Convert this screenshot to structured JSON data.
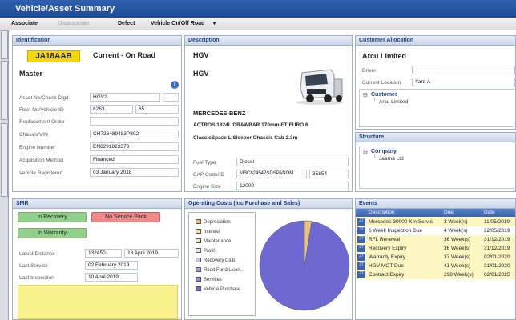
{
  "window": {
    "title": "Vehicle/Asset Summary"
  },
  "toolbar": {
    "associate": "Associate",
    "disassociate": "Disassociate",
    "defect": "Defect",
    "vehicle_on_off_road": "Vehicle On/Off Road"
  },
  "identification": {
    "header": "Identification",
    "reg": "JA18AAB",
    "status": "Current - On Road",
    "category": "Master",
    "fields": [
      {
        "label": "Asset No/Check Digit",
        "value": "HGV2"
      },
      {
        "label": "Fleet No/Vehicle ID",
        "value": "8263",
        "extra": "65"
      },
      {
        "label": "Replacement Order",
        "value": ""
      },
      {
        "label": "Chassis/VIN",
        "value": "CH726489483P802"
      },
      {
        "label": "Engine Number",
        "value": "EN6291823373"
      },
      {
        "label": "Acquisition Method",
        "value": "Financed"
      },
      {
        "label": "Vehicle Registered",
        "value": "03 January 2018"
      }
    ]
  },
  "description": {
    "header": "Description",
    "line1": "HGV",
    "line2": "HGV",
    "make": "MERCEDES-BENZ",
    "model": "ACTROS 1824L DRAWBAR 170mm ET EURO 6",
    "cab": "ClassicSpace L Sleeper Chassis Cab 2.3m",
    "fields": [
      {
        "label": "Fuel Type",
        "value": "Diesel"
      },
      {
        "label": "CAP Code/ID",
        "value": "MBC824542SDSPANOM",
        "extra": "35854"
      },
      {
        "label": "Engine Size",
        "value": "12000"
      }
    ]
  },
  "customer": {
    "header": "Customer Allocation",
    "name": "Arcu Limited",
    "driver_label": "Driver",
    "driver_value": "",
    "location_label": "Current Location",
    "location_value": "Yard A",
    "tree_root": "Customer",
    "tree_child": "Arcu Limited"
  },
  "structure": {
    "header": "Structure",
    "tree_root": "Company",
    "tree_child": "Jaarna Ltd"
  },
  "smr": {
    "header": "SMR",
    "in_recovery": "In Recovery",
    "no_service_pack": "No Service Pack",
    "in_warranty": "In Warranty",
    "fields": [
      {
        "label": "Latest Distance",
        "value": "132450",
        "date": "18 April 2019"
      },
      {
        "label": "Last Service",
        "value": "02 February 2019",
        "date": ""
      },
      {
        "label": "Last Inspection",
        "value": "10 April 2019",
        "date": ""
      }
    ]
  },
  "costs": {
    "header": "Operating Costs (Inc Purchase and Sales)",
    "legend": [
      {
        "name": "Depreciation",
        "color": "#e8c27a"
      },
      {
        "name": "Interest",
        "color": "#f2d9a0"
      },
      {
        "name": "Maintenance",
        "color": "#f7e7c4"
      },
      {
        "name": "Profit",
        "color": "#e9dff0"
      },
      {
        "name": "Recovery Club",
        "color": "#c6c3ea"
      },
      {
        "name": "Road Fund Licen..",
        "color": "#a7a3e0"
      },
      {
        "name": "Services",
        "color": "#8f8ad8"
      },
      {
        "name": "Vehicle Purchase..",
        "color": "#6d69d0"
      }
    ]
  },
  "events": {
    "header": "Events",
    "columns": [
      "Description",
      "Due",
      "Date"
    ],
    "rows": [
      {
        "description": "Mercedes 30000 Km Servic",
        "due": "3 Week(s)",
        "date": "11/05/2019"
      },
      {
        "description": "6 Week Inspection Due",
        "due": "4 Week(s)",
        "date": "22/05/2019"
      },
      {
        "description": "RFL Renewal",
        "due": "36 Week(s)",
        "date": "31/12/2019"
      },
      {
        "description": "Recovery Expiry",
        "due": "36 Week(s)",
        "date": "31/12/2019"
      },
      {
        "description": "Warranty Expiry",
        "due": "37 Week(s)",
        "date": "02/01/2020"
      },
      {
        "description": "HGV MOT Due",
        "due": "41 Week(s)",
        "date": "31/01/2020"
      },
      {
        "description": "Contract Expiry",
        "due": "298 Week(s)",
        "date": "02/01/2025"
      }
    ]
  },
  "colors": {
    "title_bar": "#1f4a94",
    "reg_plate": "#f5d800",
    "recovery_green": "#8fd18c",
    "no_service_red": "#f08a8a",
    "smr_note_yellow": "#f7f28c",
    "pie_main": "#6d69d0",
    "pie_slice": "#e8c27a"
  }
}
